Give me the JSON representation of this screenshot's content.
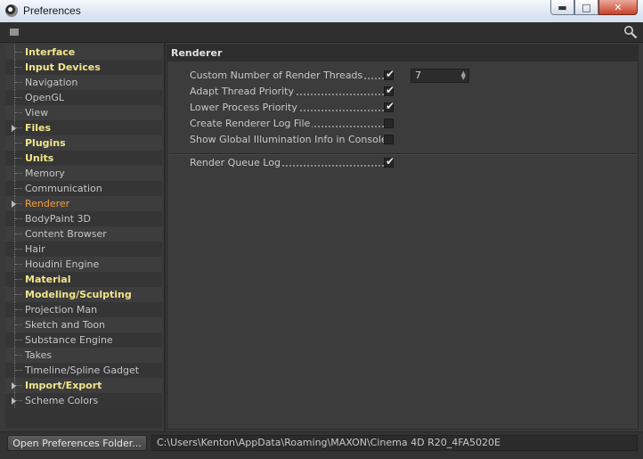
{
  "window": {
    "title": "Preferences",
    "minimize": "▬",
    "maximize": "□",
    "close": "✕"
  },
  "tree": {
    "items": [
      {
        "label": "Interface",
        "bold": true,
        "expandable": false
      },
      {
        "label": "Input Devices",
        "bold": true,
        "expandable": false
      },
      {
        "label": "Navigation",
        "bold": false,
        "expandable": false
      },
      {
        "label": "OpenGL",
        "bold": false,
        "expandable": false
      },
      {
        "label": "View",
        "bold": false,
        "expandable": false
      },
      {
        "label": "Files",
        "bold": true,
        "expandable": true
      },
      {
        "label": "Plugins",
        "bold": true,
        "expandable": false
      },
      {
        "label": "Units",
        "bold": true,
        "expandable": false
      },
      {
        "label": "Memory",
        "bold": false,
        "expandable": false
      },
      {
        "label": "Communication",
        "bold": false,
        "expandable": false
      },
      {
        "label": "Renderer",
        "bold": false,
        "expandable": true,
        "selected": true
      },
      {
        "label": "BodyPaint 3D",
        "bold": false,
        "expandable": false
      },
      {
        "label": "Content Browser",
        "bold": false,
        "expandable": false
      },
      {
        "label": "Hair",
        "bold": false,
        "expandable": false
      },
      {
        "label": "Houdini Engine",
        "bold": false,
        "expandable": false
      },
      {
        "label": "Material",
        "bold": true,
        "expandable": false
      },
      {
        "label": "Modeling/Sculpting",
        "bold": true,
        "expandable": false
      },
      {
        "label": "Projection Man",
        "bold": false,
        "expandable": false
      },
      {
        "label": "Sketch and Toon",
        "bold": false,
        "expandable": false
      },
      {
        "label": "Substance Engine",
        "bold": false,
        "expandable": false
      },
      {
        "label": "Takes",
        "bold": false,
        "expandable": false
      },
      {
        "label": "Timeline/Spline Gadget",
        "bold": false,
        "expandable": false
      },
      {
        "label": "Import/Export",
        "bold": true,
        "expandable": true
      },
      {
        "label": "Scheme Colors",
        "bold": false,
        "expandable": true
      }
    ]
  },
  "panel": {
    "header": "Renderer",
    "options": [
      {
        "label": "Custom Number of Render Threads",
        "checked": true
      },
      {
        "label": "Adapt Thread Priority",
        "checked": true
      },
      {
        "label": "Lower Process Priority",
        "checked": true
      },
      {
        "label": "Create Renderer Log File",
        "checked": false
      },
      {
        "label": "Show Global Illumination Info in Console",
        "checked": false
      }
    ],
    "threads_value": "7",
    "queue_option": {
      "label": "Render Queue Log",
      "checked": true
    }
  },
  "bottom": {
    "open_button": "Open Preferences Folder...",
    "path": "C:\\Users\\Kenton\\AppData\\Roaming\\MAXON\\Cinema 4D R20_4FA5020E"
  },
  "colors": {
    "bold_item": "#f0e68c",
    "selected_item": "#f5a040",
    "background": "#3a3a3a"
  },
  "icons": {
    "grip": "grip-icon",
    "search": "search-icon",
    "check": "check-icon"
  }
}
